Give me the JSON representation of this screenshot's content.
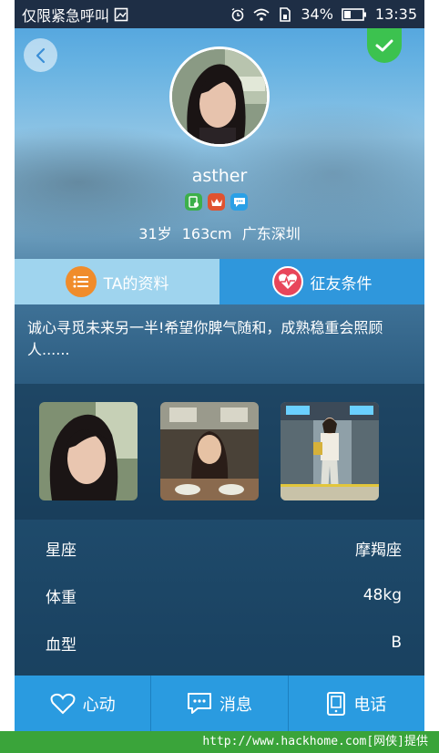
{
  "status_bar": {
    "carrier_text": "仅限紧急呼叫",
    "battery_percent": "34%",
    "time": "13:35",
    "icons": [
      "screenshot-icon",
      "alarm-icon",
      "wifi-icon",
      "sim-icon",
      "battery-icon"
    ]
  },
  "profile": {
    "username": "asther",
    "basic_info": "31岁 163cm 广东深圳",
    "badges": [
      {
        "icon": "verified-phone-icon",
        "color": "#3cb04a"
      },
      {
        "icon": "vip-crown-icon",
        "color": "#e0522f"
      },
      {
        "icon": "message-bubble-icon",
        "color": "#2aa0e6"
      }
    ]
  },
  "tabs": [
    {
      "label": "TA的资料",
      "icon": "list-icon",
      "icon_color": "#f08c2b",
      "active": true
    },
    {
      "label": "征友条件",
      "icon": "heartbeat-icon",
      "icon_color": "#e8455a",
      "active": false
    }
  ],
  "intro": "诚心寻觅未来另一半!希望你脾气随和，成熟稳重会照顾人......",
  "photos": [
    "portrait-photo",
    "restaurant-photo",
    "station-photo"
  ],
  "details": [
    {
      "label": "星座",
      "value": "摩羯座"
    },
    {
      "label": "体重",
      "value": "48kg"
    },
    {
      "label": "血型",
      "value": "B"
    }
  ],
  "bottom_bar": [
    {
      "label": "心动",
      "icon": "heart-outline-icon"
    },
    {
      "label": "消息",
      "icon": "chat-icon"
    },
    {
      "label": "电话",
      "icon": "phone-icon"
    }
  ],
  "watermark": "http://www.hackhome.com[网侠]提供",
  "colors": {
    "confirm": "#3cc24f",
    "tab_active": "#9fd4ee",
    "tab_inactive": "#2f97dc",
    "bottom_bar": "#2a9be0",
    "footer": "#3aa43a"
  }
}
